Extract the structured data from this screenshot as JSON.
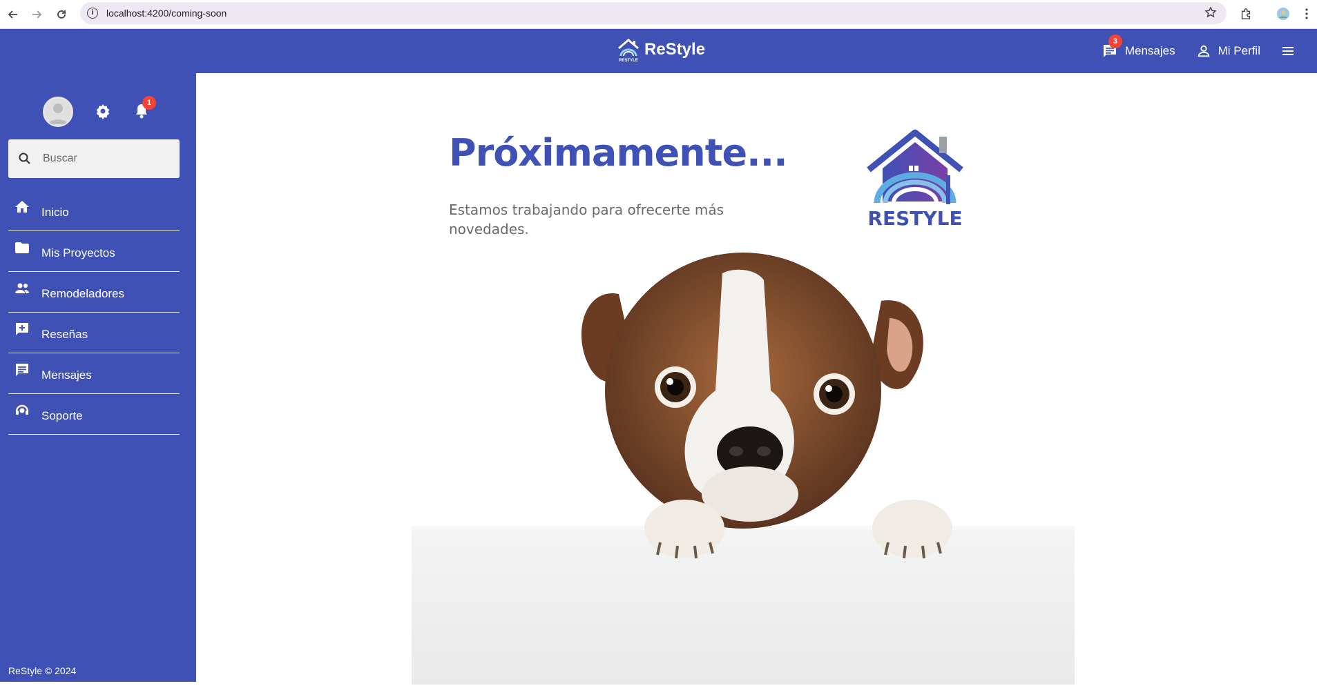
{
  "browser": {
    "url": "localhost:4200/coming-soon"
  },
  "topbar": {
    "brand": "ReStyle",
    "messages_label": "Mensajes",
    "messages_badge": "3",
    "profile_label": "Mi Perfil"
  },
  "sidebar": {
    "notifications_badge": "1",
    "search_placeholder": "Buscar",
    "items": [
      {
        "label": "Inicio",
        "icon": "home-icon"
      },
      {
        "label": "Mis Proyectos",
        "icon": "folder-icon"
      },
      {
        "label": "Remodeladores",
        "icon": "people-icon"
      },
      {
        "label": "Reseñas",
        "icon": "rate-review-icon"
      },
      {
        "label": "Mensajes",
        "icon": "chat-icon"
      },
      {
        "label": "Soporte",
        "icon": "support-agent-icon"
      }
    ],
    "footer": "ReStyle © 2024"
  },
  "main": {
    "title": "Próximamente...",
    "subtitle": "Estamos trabajando para ofrecerte más novedades.",
    "logo_text": "RESTYLE"
  },
  "colors": {
    "primary": "#3f51b5",
    "badge": "#f44336"
  }
}
